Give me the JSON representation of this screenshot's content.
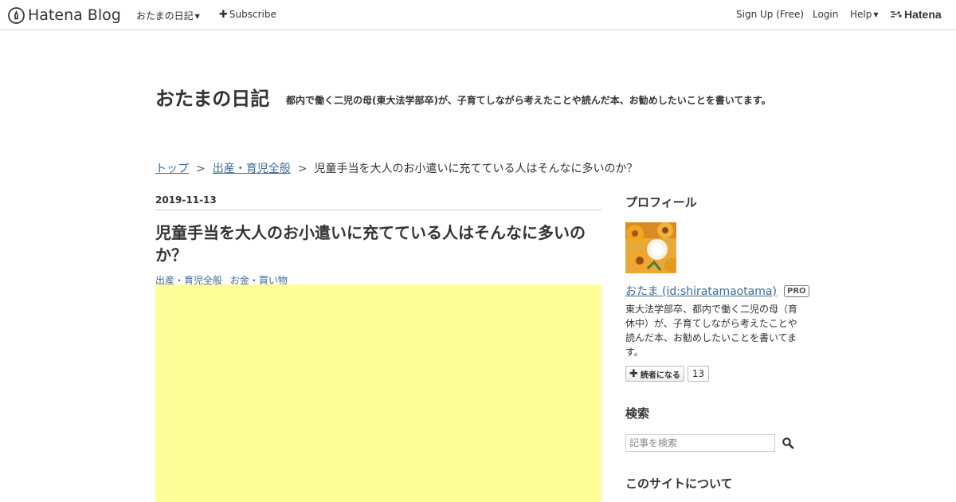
{
  "global_header": {
    "logo_text": "Hatena Blog",
    "blog_menu": "おたまの日記",
    "subscribe": "Subscribe",
    "signup": "Sign Up (Free)",
    "login": "Login",
    "help": "Help",
    "hatena_logo": "Hatena"
  },
  "blog": {
    "title": "おたまの日記",
    "description": "都内で働く二児の母(東大法学部卒)が、子育てしながら考えたことや読んだ本、お勧めしたいことを書いてます。"
  },
  "breadcrumb": {
    "items": [
      "トップ",
      "出産・育児全般"
    ],
    "separator": ">",
    "current": "児童手当を大人のお小遣いに充てている人はそんなに多いのか？"
  },
  "entry": {
    "date": "2019-11-13",
    "title": "児童手当を大人のお小遣いに充てている人はそんなに多いのか？",
    "categories": [
      "出産・育児全般",
      "お金・買い物"
    ]
  },
  "sidebar": {
    "profile_heading": "プロフィール",
    "profile_name": "おたま (id:shiratamaotama)",
    "pro_badge": "PRO",
    "profile_description": "東大法学部卒、都内で働く二児の母（育休中）が、子育てしながら考えたことや読んだ本、お勧めしたいことを書いてます。",
    "subscribe_label": "読者になる",
    "subscriber_count": "13",
    "search_heading": "検索",
    "search_placeholder": "記事を検索",
    "about_heading": "このサイトについて"
  },
  "colors": {
    "link": "#3c6a97",
    "ad_background": "#ffff99",
    "text": "#333333"
  }
}
